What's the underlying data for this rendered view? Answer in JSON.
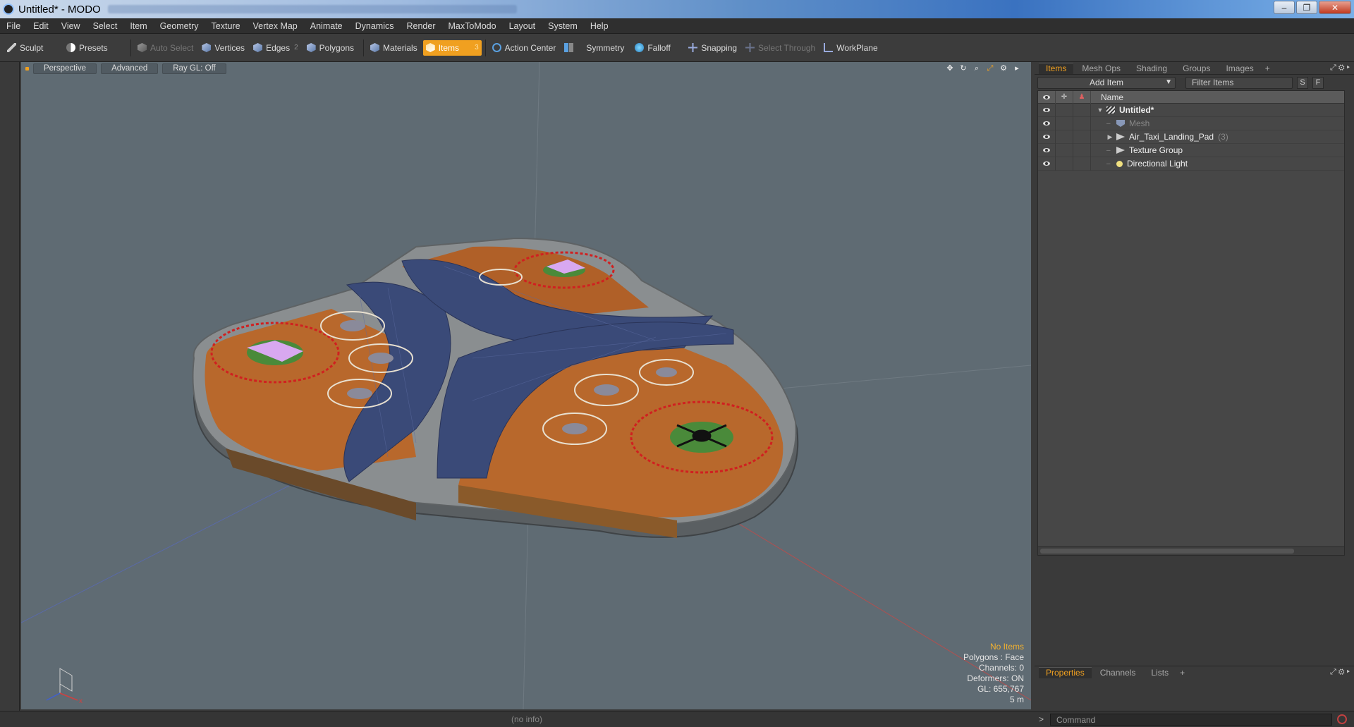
{
  "window": {
    "title": "Untitled* - MODO",
    "controls": [
      "–",
      "❐",
      "✕"
    ]
  },
  "menu": [
    "File",
    "Edit",
    "View",
    "Select",
    "Item",
    "Geometry",
    "Texture",
    "Vertex Map",
    "Animate",
    "Dynamics",
    "Render",
    "MaxToModo",
    "Layout",
    "System",
    "Help"
  ],
  "toolbar": {
    "sculpt": "Sculpt",
    "presets": "Presets",
    "auto_select": "Auto Select",
    "vertices": "Vertices",
    "edges": "Edges",
    "edges_count": "2",
    "polygons": "Polygons",
    "materials": "Materials",
    "items": "Items",
    "items_count": "3",
    "action_center": "Action Center",
    "symmetry": "Symmetry",
    "falloff": "Falloff",
    "snapping": "Snapping",
    "select_through": "Select Through",
    "workplane": "WorkPlane"
  },
  "viewport": {
    "tabs": [
      "Perspective",
      "Advanced",
      "Ray GL: Off"
    ],
    "stats": {
      "selection": "No Items",
      "polygons": "Polygons : Face",
      "channels": "Channels: 0",
      "deformers": "Deformers: ON",
      "gl": "GL: 655,767",
      "scale": "5 m"
    }
  },
  "right_panel": {
    "tabs": [
      "Items",
      "Mesh Ops",
      "Shading",
      "Groups",
      "Images"
    ],
    "add_item": "Add Item",
    "filter_placeholder": "Filter Items",
    "s_button": "S",
    "f_button": "F",
    "name_header": "Name",
    "tree": [
      {
        "name": "Untitled*",
        "icon": "clapper-icon"
      },
      {
        "name": "Mesh",
        "icon": "mesh-icon"
      },
      {
        "name": "Air_Taxi_Landing_Pad",
        "count": "(3)",
        "icon": "group-icon"
      },
      {
        "name": "Texture Group",
        "icon": "group-icon"
      },
      {
        "name": "Directional Light",
        "icon": "light-icon"
      }
    ],
    "bottom_tabs": [
      "Properties",
      "Channels",
      "Lists"
    ]
  },
  "status": {
    "info": "(no info)",
    "prompt": ">",
    "command_placeholder": "Command"
  },
  "colors": {
    "accent": "#f0a020",
    "viewport_bg": "#5f6b73",
    "pad_orange": "#b8682c",
    "solar_blue": "#3a4a78",
    "red_ring": "#d02020"
  }
}
